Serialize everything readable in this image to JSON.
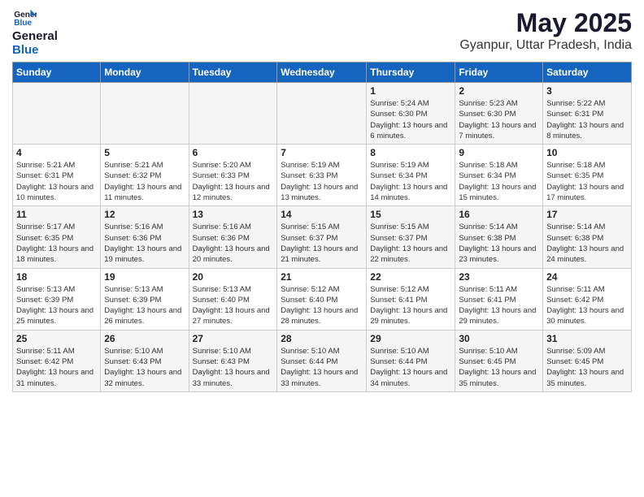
{
  "header": {
    "logo_general": "General",
    "logo_blue": "Blue",
    "title": "May 2025",
    "subtitle": "Gyanpur, Uttar Pradesh, India"
  },
  "days_of_week": [
    "Sunday",
    "Monday",
    "Tuesday",
    "Wednesday",
    "Thursday",
    "Friday",
    "Saturday"
  ],
  "weeks": [
    [
      {
        "day": "",
        "info": ""
      },
      {
        "day": "",
        "info": ""
      },
      {
        "day": "",
        "info": ""
      },
      {
        "day": "",
        "info": ""
      },
      {
        "day": "1",
        "info": "Sunrise: 5:24 AM\nSunset: 6:30 PM\nDaylight: 13 hours and 6 minutes."
      },
      {
        "day": "2",
        "info": "Sunrise: 5:23 AM\nSunset: 6:30 PM\nDaylight: 13 hours and 7 minutes."
      },
      {
        "day": "3",
        "info": "Sunrise: 5:22 AM\nSunset: 6:31 PM\nDaylight: 13 hours and 8 minutes."
      }
    ],
    [
      {
        "day": "4",
        "info": "Sunrise: 5:21 AM\nSunset: 6:31 PM\nDaylight: 13 hours and 10 minutes."
      },
      {
        "day": "5",
        "info": "Sunrise: 5:21 AM\nSunset: 6:32 PM\nDaylight: 13 hours and 11 minutes."
      },
      {
        "day": "6",
        "info": "Sunrise: 5:20 AM\nSunset: 6:33 PM\nDaylight: 13 hours and 12 minutes."
      },
      {
        "day": "7",
        "info": "Sunrise: 5:19 AM\nSunset: 6:33 PM\nDaylight: 13 hours and 13 minutes."
      },
      {
        "day": "8",
        "info": "Sunrise: 5:19 AM\nSunset: 6:34 PM\nDaylight: 13 hours and 14 minutes."
      },
      {
        "day": "9",
        "info": "Sunrise: 5:18 AM\nSunset: 6:34 PM\nDaylight: 13 hours and 15 minutes."
      },
      {
        "day": "10",
        "info": "Sunrise: 5:18 AM\nSunset: 6:35 PM\nDaylight: 13 hours and 17 minutes."
      }
    ],
    [
      {
        "day": "11",
        "info": "Sunrise: 5:17 AM\nSunset: 6:35 PM\nDaylight: 13 hours and 18 minutes."
      },
      {
        "day": "12",
        "info": "Sunrise: 5:16 AM\nSunset: 6:36 PM\nDaylight: 13 hours and 19 minutes."
      },
      {
        "day": "13",
        "info": "Sunrise: 5:16 AM\nSunset: 6:36 PM\nDaylight: 13 hours and 20 minutes."
      },
      {
        "day": "14",
        "info": "Sunrise: 5:15 AM\nSunset: 6:37 PM\nDaylight: 13 hours and 21 minutes."
      },
      {
        "day": "15",
        "info": "Sunrise: 5:15 AM\nSunset: 6:37 PM\nDaylight: 13 hours and 22 minutes."
      },
      {
        "day": "16",
        "info": "Sunrise: 5:14 AM\nSunset: 6:38 PM\nDaylight: 13 hours and 23 minutes."
      },
      {
        "day": "17",
        "info": "Sunrise: 5:14 AM\nSunset: 6:38 PM\nDaylight: 13 hours and 24 minutes."
      }
    ],
    [
      {
        "day": "18",
        "info": "Sunrise: 5:13 AM\nSunset: 6:39 PM\nDaylight: 13 hours and 25 minutes."
      },
      {
        "day": "19",
        "info": "Sunrise: 5:13 AM\nSunset: 6:39 PM\nDaylight: 13 hours and 26 minutes."
      },
      {
        "day": "20",
        "info": "Sunrise: 5:13 AM\nSunset: 6:40 PM\nDaylight: 13 hours and 27 minutes."
      },
      {
        "day": "21",
        "info": "Sunrise: 5:12 AM\nSunset: 6:40 PM\nDaylight: 13 hours and 28 minutes."
      },
      {
        "day": "22",
        "info": "Sunrise: 5:12 AM\nSunset: 6:41 PM\nDaylight: 13 hours and 29 minutes."
      },
      {
        "day": "23",
        "info": "Sunrise: 5:11 AM\nSunset: 6:41 PM\nDaylight: 13 hours and 29 minutes."
      },
      {
        "day": "24",
        "info": "Sunrise: 5:11 AM\nSunset: 6:42 PM\nDaylight: 13 hours and 30 minutes."
      }
    ],
    [
      {
        "day": "25",
        "info": "Sunrise: 5:11 AM\nSunset: 6:42 PM\nDaylight: 13 hours and 31 minutes."
      },
      {
        "day": "26",
        "info": "Sunrise: 5:10 AM\nSunset: 6:43 PM\nDaylight: 13 hours and 32 minutes."
      },
      {
        "day": "27",
        "info": "Sunrise: 5:10 AM\nSunset: 6:43 PM\nDaylight: 13 hours and 33 minutes."
      },
      {
        "day": "28",
        "info": "Sunrise: 5:10 AM\nSunset: 6:44 PM\nDaylight: 13 hours and 33 minutes."
      },
      {
        "day": "29",
        "info": "Sunrise: 5:10 AM\nSunset: 6:44 PM\nDaylight: 13 hours and 34 minutes."
      },
      {
        "day": "30",
        "info": "Sunrise: 5:10 AM\nSunset: 6:45 PM\nDaylight: 13 hours and 35 minutes."
      },
      {
        "day": "31",
        "info": "Sunrise: 5:09 AM\nSunset: 6:45 PM\nDaylight: 13 hours and 35 minutes."
      }
    ]
  ]
}
